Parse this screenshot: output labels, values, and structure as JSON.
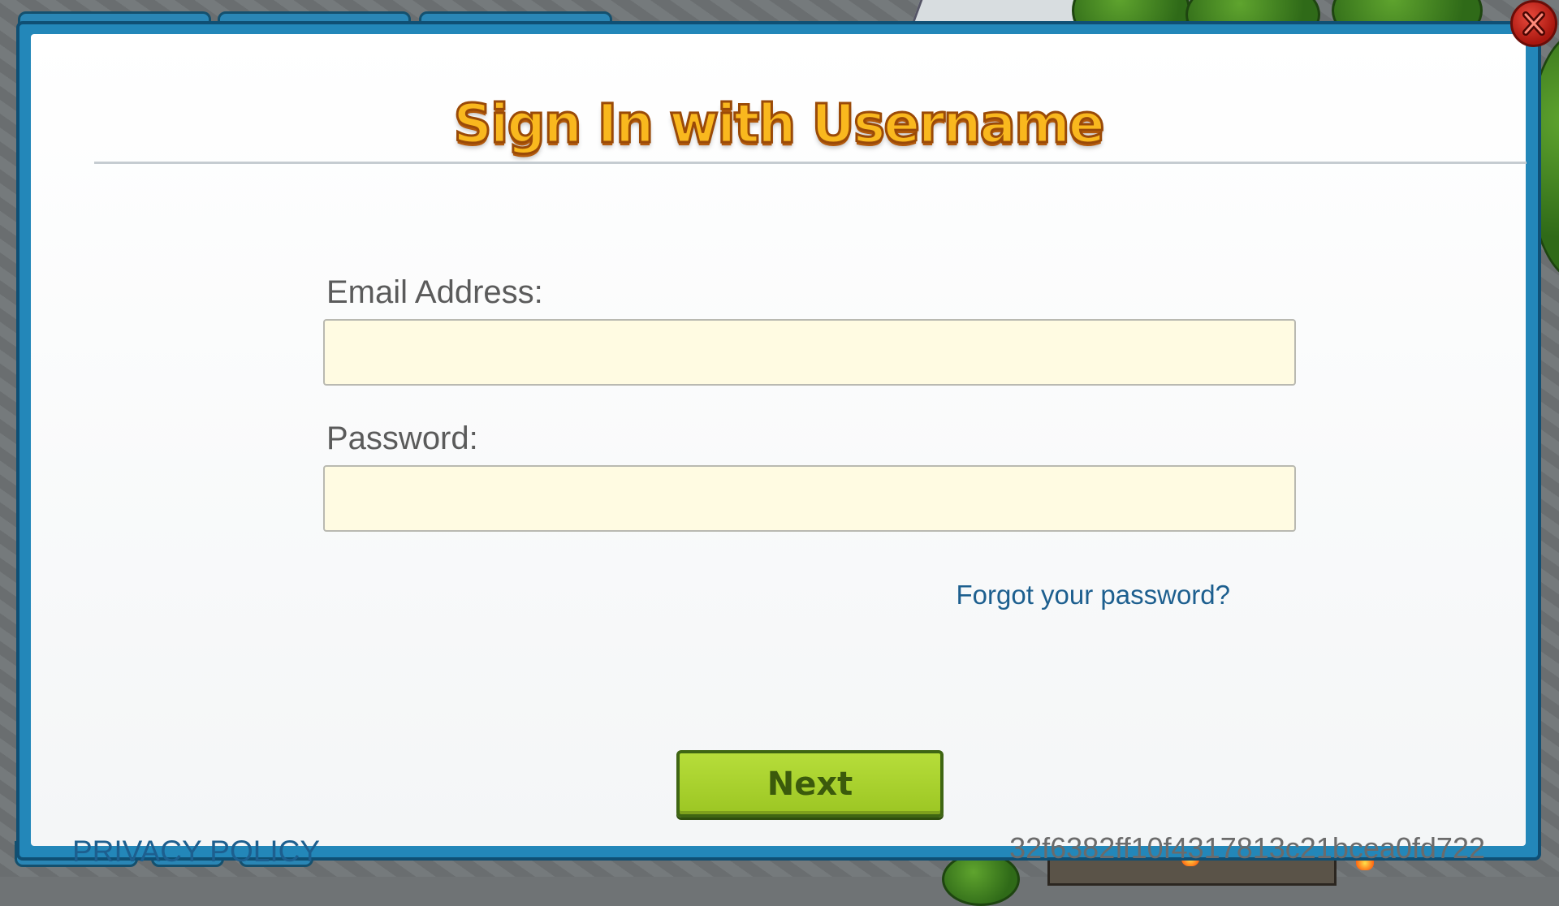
{
  "dialog": {
    "title": "Sign In with Username",
    "email_label": "Email Address:",
    "email_value": "",
    "password_label": "Password:",
    "password_value": "",
    "forgot_password": "Forgot your password?",
    "next_button": "Next",
    "privacy_policy": "PRIVACY POLICY",
    "session_id": "32f6382ff10f4317813c21bcea0fd722",
    "close_icon": "close-icon"
  },
  "colors": {
    "frame_blue": "#2387b9",
    "title_orange": "#f9b81e",
    "link_blue": "#1d5f8f",
    "input_fill": "#fffbe2",
    "button_green": "#9cc623",
    "close_red": "#c4261b"
  }
}
